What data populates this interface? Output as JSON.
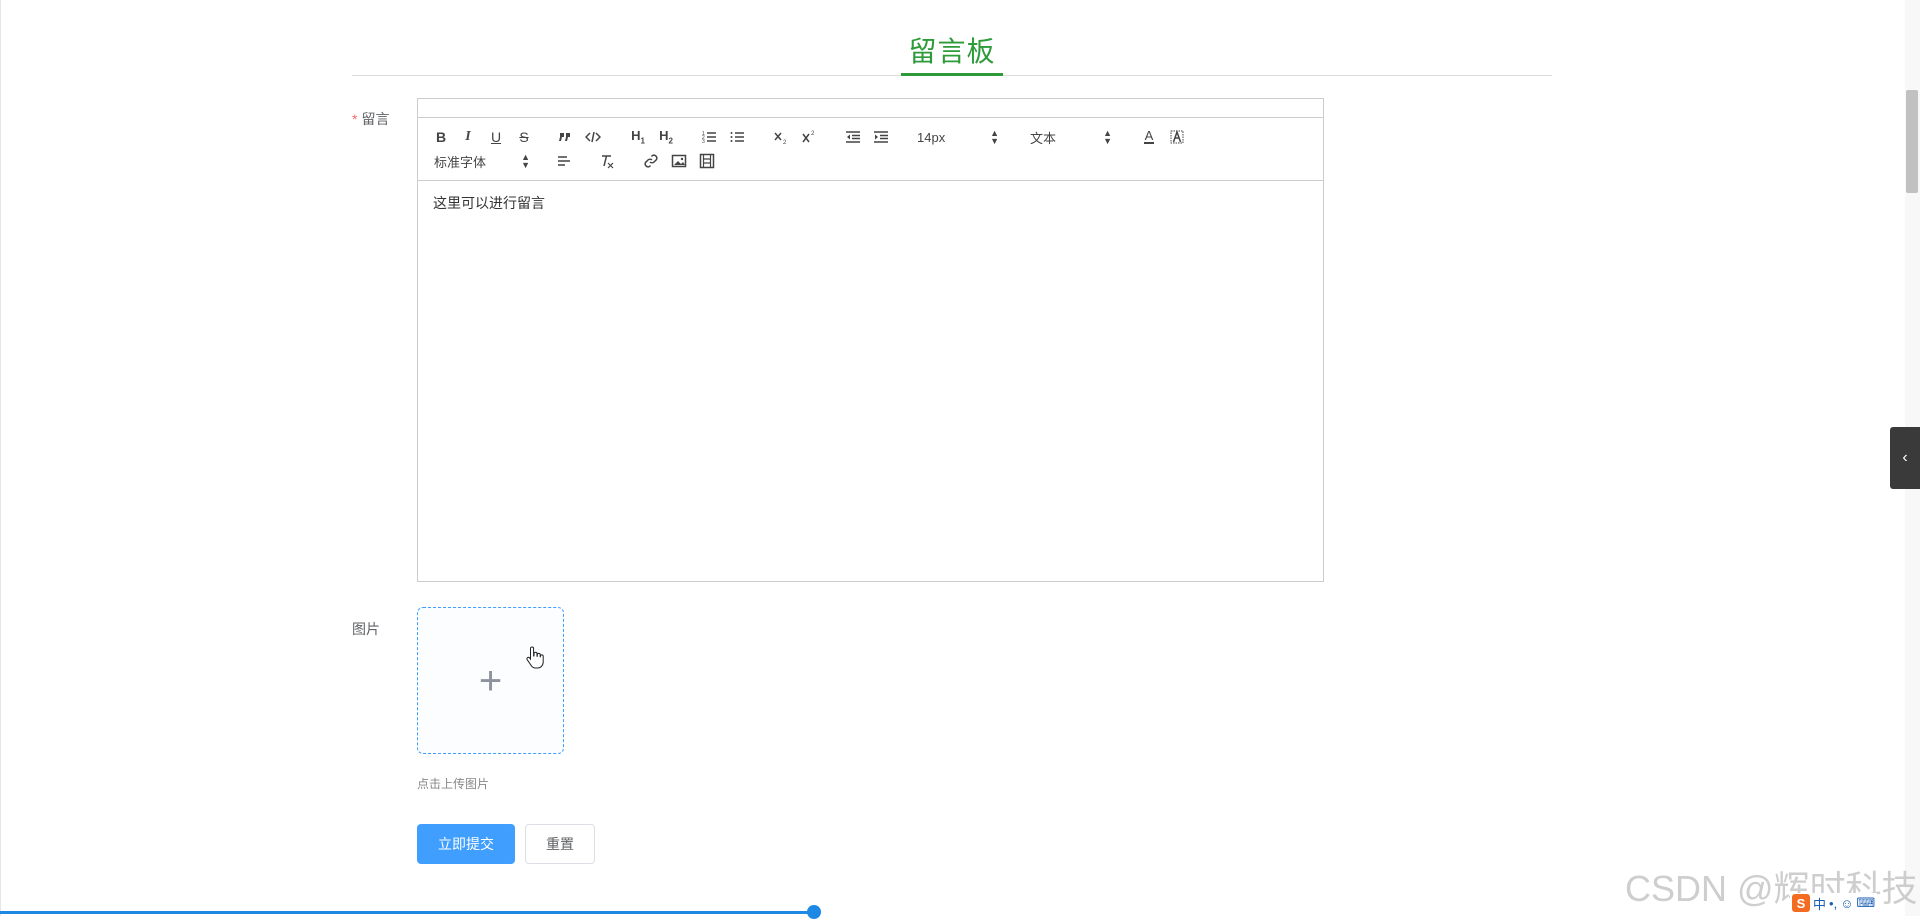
{
  "page": {
    "title": "留言板"
  },
  "form": {
    "message_label": "留言",
    "required_mark": "*",
    "image_label": "图片",
    "upload_tip": "点击上传图片",
    "submit_label": "立即提交",
    "reset_label": "重置"
  },
  "editor": {
    "content": "这里可以进行留言",
    "font_size_value": "14px",
    "header_value": "文本",
    "font_family_value": "标准字体",
    "toolbar_labels": {
      "bold": "B",
      "italic": "I",
      "underline": "U",
      "strike": "S",
      "h1": "H",
      "h1_sub": "1",
      "h2": "H",
      "h2_sub": "2",
      "font_color": "A"
    }
  },
  "watermark": "CSDN @辉时科技",
  "ime": {
    "logo": "S",
    "lang": "中",
    "punct": "•,"
  },
  "colors": {
    "accent": "#2e9b3b",
    "primary": "#409eff"
  },
  "icons": [
    "bold-icon",
    "italic-icon",
    "underline-icon",
    "strikethrough-icon",
    "blockquote-icon",
    "code-block-icon",
    "ordered-list-icon",
    "bullet-list-icon",
    "subscript-icon",
    "superscript-icon",
    "outdent-icon",
    "indent-icon",
    "font-color-icon",
    "background-color-icon",
    "align-left-icon",
    "clear-format-icon",
    "link-icon",
    "image-icon",
    "video-icon",
    "plus-icon",
    "chevron-left-icon",
    "hand-cursor-icon"
  ]
}
